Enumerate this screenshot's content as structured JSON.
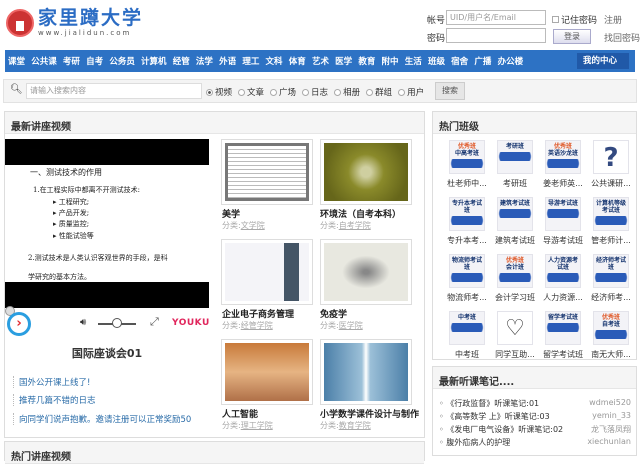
{
  "header": {
    "site_name": "家里蹲大学",
    "site_url": "www.jialidun.com",
    "account_label": "帐号",
    "account_placeholder": "UID/用户名/Email",
    "remember_label": "记住密码",
    "register_link": "注册",
    "password_label": "密码",
    "login_button": "登录",
    "forgot_link": "找回密码"
  },
  "nav": {
    "items": [
      "课堂",
      "公共课",
      "考研",
      "自考",
      "公务员",
      "计算机",
      "经管",
      "法学",
      "外语",
      "理工",
      "文科",
      "体育",
      "艺术",
      "医学",
      "教育",
      "附中",
      "生活",
      "班级",
      "宿舍",
      "广播",
      "办公楼"
    ],
    "my_center": "我的中心"
  },
  "search": {
    "placeholder": "请输入搜索内容",
    "options": [
      "视频",
      "文章",
      "广场",
      "日志",
      "相册",
      "群组",
      "用户"
    ],
    "selected": "视频",
    "button": "搜索"
  },
  "lectures": {
    "title": "最新讲座视频",
    "player": {
      "slide_lines": [
        "一、测试技术的作用",
        "1.在工程实际中都离不开测试技术:",
        "工程研究;",
        "产品开发;",
        "质量监控;",
        "性能试验等",
        "2.测试技术是人类认识客观世界的手段，是科",
        "学研究的基本方法。"
      ],
      "brand": "YOUKU",
      "volume": 0.5
    },
    "featured_title": "国际座谈会01",
    "links": [
      "国外公开课上线了!",
      "推荐几篇不错的日志",
      "向同学们说声抱歉。邀请注册可以正常奖励50"
    ],
    "videos": [
      {
        "title": "美学",
        "category_label": "分类:",
        "category": "文学院"
      },
      {
        "title": "环境法（自考本科）",
        "category_label": "分类:",
        "category": "自考学院"
      },
      {
        "title": "企业电子商务管理",
        "category_label": "分类:",
        "category": "经管学院"
      },
      {
        "title": "免疫学",
        "category_label": "分类:",
        "category": "医学院"
      },
      {
        "title": "人工智能",
        "category_label": "分类:",
        "category": "理工学院"
      },
      {
        "title": "小学数学课件设计与制作",
        "category_label": "分类:",
        "category": "教育学院"
      }
    ]
  },
  "hot_lectures": {
    "title": "热门讲座视频"
  },
  "classes": {
    "title": "热门班级",
    "items": [
      {
        "name": "杜老师中...",
        "badge": "优秀班",
        "icon_text": "中高考班"
      },
      {
        "name": "考研班",
        "badge": "",
        "icon_text": "考研班"
      },
      {
        "name": "姜老师英...",
        "badge": "优秀班",
        "icon_text": "英语沙龙班"
      },
      {
        "name": "公共课研...",
        "badge": "",
        "icon_text": "?"
      },
      {
        "name": "专升本考...",
        "badge": "",
        "icon_text": "专升本考试班"
      },
      {
        "name": "建筑考试班",
        "badge": "",
        "icon_text": "建筑考试班"
      },
      {
        "name": "导游考试班",
        "badge": "",
        "icon_text": "导游考试班"
      },
      {
        "name": "管老师计...",
        "badge": "",
        "icon_text": "计算机等级考试班"
      },
      {
        "name": "物流师考...",
        "badge": "",
        "icon_text": "物流师考试班"
      },
      {
        "name": "会计学习班",
        "badge": "优秀班",
        "icon_text": "会计班"
      },
      {
        "name": "人力资源...",
        "badge": "",
        "icon_text": "人力资源考试班"
      },
      {
        "name": "经济师考...",
        "badge": "",
        "icon_text": "经济师考试班"
      },
      {
        "name": "中考班",
        "badge": "",
        "icon_text": "中考班"
      },
      {
        "name": "同学互助...",
        "badge": "",
        "icon_text": "handshake"
      },
      {
        "name": "留学考试班",
        "badge": "",
        "icon_text": "留学考试班"
      },
      {
        "name": "南无大师...",
        "badge": "优秀班",
        "icon_text": "自考班"
      }
    ]
  },
  "notes": {
    "title": "最新听课笔记....",
    "items": [
      {
        "title": "《行政监督》听课笔记:01",
        "user": "wdmei520"
      },
      {
        "title": "《高等数学 上》听课笔记:03",
        "user": "yemin_33"
      },
      {
        "title": "《发电厂电气设备》听课笔记:02",
        "user": "龙飞落凤翔"
      },
      {
        "title": "腹外疝病人的护理",
        "user": "xiechunlan"
      }
    ]
  },
  "colors": {
    "nav": "#2d72c4",
    "brand": "#2b6cc4",
    "link": "#2a6ca8"
  }
}
